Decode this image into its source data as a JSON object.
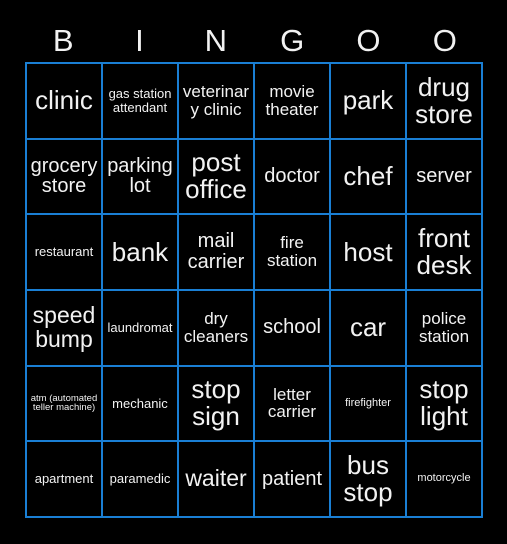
{
  "card": {
    "background_color": "#000000",
    "grid_line_color": "#1a7fd4",
    "text_color": "#f2f2f2",
    "columns": 6,
    "rows": 6,
    "header": {
      "letters": [
        "B",
        "I",
        "N",
        "G",
        "O",
        "O"
      ]
    },
    "cells": [
      [
        {
          "text": "clinic",
          "size": "sz-xxl"
        },
        {
          "text": "gas station attendant",
          "size": "sz-s"
        },
        {
          "text": "veterinary clinic",
          "size": "sz-m"
        },
        {
          "text": "movie theater",
          "size": "sz-m"
        },
        {
          "text": "park",
          "size": "sz-xxl"
        },
        {
          "text": "drug store",
          "size": "sz-xxl"
        }
      ],
      [
        {
          "text": "grocery store",
          "size": "sz-l"
        },
        {
          "text": "parking lot",
          "size": "sz-l"
        },
        {
          "text": "post office",
          "size": "sz-xxl"
        },
        {
          "text": "doctor",
          "size": "sz-l"
        },
        {
          "text": "chef",
          "size": "sz-xxl"
        },
        {
          "text": "server",
          "size": "sz-l"
        }
      ],
      [
        {
          "text": "restaurant",
          "size": "sz-s"
        },
        {
          "text": "bank",
          "size": "sz-xxl"
        },
        {
          "text": "mail carrier",
          "size": "sz-l"
        },
        {
          "text": "fire station",
          "size": "sz-m"
        },
        {
          "text": "host",
          "size": "sz-xxl"
        },
        {
          "text": "front desk",
          "size": "sz-xxl"
        }
      ],
      [
        {
          "text": "speed bump",
          "size": "sz-xl"
        },
        {
          "text": "laundromat",
          "size": "sz-s"
        },
        {
          "text": "dry cleaners",
          "size": "sz-m"
        },
        {
          "text": "school",
          "size": "sz-l"
        },
        {
          "text": "car",
          "size": "sz-xxl"
        },
        {
          "text": "police station",
          "size": "sz-m"
        }
      ],
      [
        {
          "text": "atm (automated teller machine)",
          "size": "sz-xxs"
        },
        {
          "text": "mechanic",
          "size": "sz-s"
        },
        {
          "text": "stop sign",
          "size": "sz-xxl"
        },
        {
          "text": "letter carrier",
          "size": "sz-m"
        },
        {
          "text": "firefighter",
          "size": "sz-xs"
        },
        {
          "text": "stop light",
          "size": "sz-xxl"
        }
      ],
      [
        {
          "text": "apartment",
          "size": "sz-s"
        },
        {
          "text": "paramedic",
          "size": "sz-s"
        },
        {
          "text": "waiter",
          "size": "sz-xl"
        },
        {
          "text": "patient",
          "size": "sz-l"
        },
        {
          "text": "bus stop",
          "size": "sz-xxl"
        },
        {
          "text": "motorcycle",
          "size": "sz-xs"
        }
      ]
    ]
  }
}
